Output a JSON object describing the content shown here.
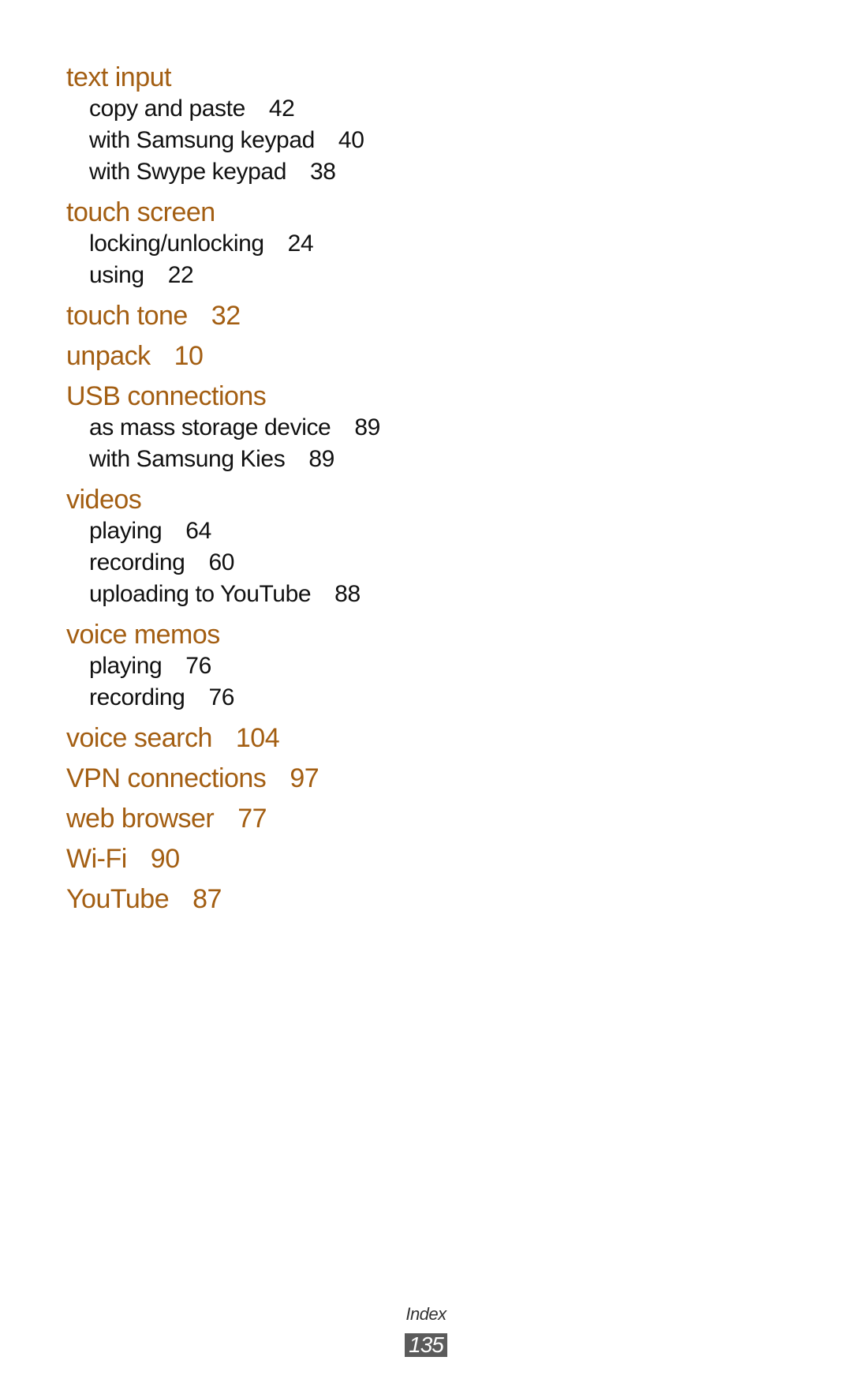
{
  "entries": [
    {
      "term": "text input",
      "page": "",
      "subs": [
        {
          "term": "copy and paste",
          "page": "42"
        },
        {
          "term": "with Samsung keypad",
          "page": "40"
        },
        {
          "term": "with Swype keypad",
          "page": "38"
        }
      ]
    },
    {
      "term": "touch screen",
      "page": "",
      "subs": [
        {
          "term": "locking/unlocking",
          "page": "24"
        },
        {
          "term": "using",
          "page": "22"
        }
      ]
    },
    {
      "term": "touch tone",
      "page": "32",
      "subs": []
    },
    {
      "term": "unpack",
      "page": "10",
      "subs": []
    },
    {
      "term": "USB connections",
      "page": "",
      "subs": [
        {
          "term": "as mass storage device",
          "page": "89"
        },
        {
          "term": "with Samsung Kies",
          "page": "89"
        }
      ]
    },
    {
      "term": "videos",
      "page": "",
      "subs": [
        {
          "term": "playing",
          "page": "64"
        },
        {
          "term": "recording",
          "page": "60"
        },
        {
          "term": "uploading to YouTube",
          "page": "88"
        }
      ]
    },
    {
      "term": "voice memos",
      "page": "",
      "subs": [
        {
          "term": "playing",
          "page": "76"
        },
        {
          "term": "recording",
          "page": "76"
        }
      ]
    },
    {
      "term": "voice search",
      "page": "104",
      "subs": []
    },
    {
      "term": "VPN connections",
      "page": "97",
      "subs": []
    },
    {
      "term": "web browser",
      "page": "77",
      "subs": []
    },
    {
      "term": "Wi-Fi",
      "page": "90",
      "subs": []
    },
    {
      "term": "YouTube",
      "page": "87",
      "subs": []
    }
  ],
  "footer": {
    "section_label": "Index",
    "page_number": "135"
  },
  "colors": {
    "heading": "#a35e12",
    "subentry": "#111111",
    "page_badge_bg": "#5b5b5b"
  }
}
